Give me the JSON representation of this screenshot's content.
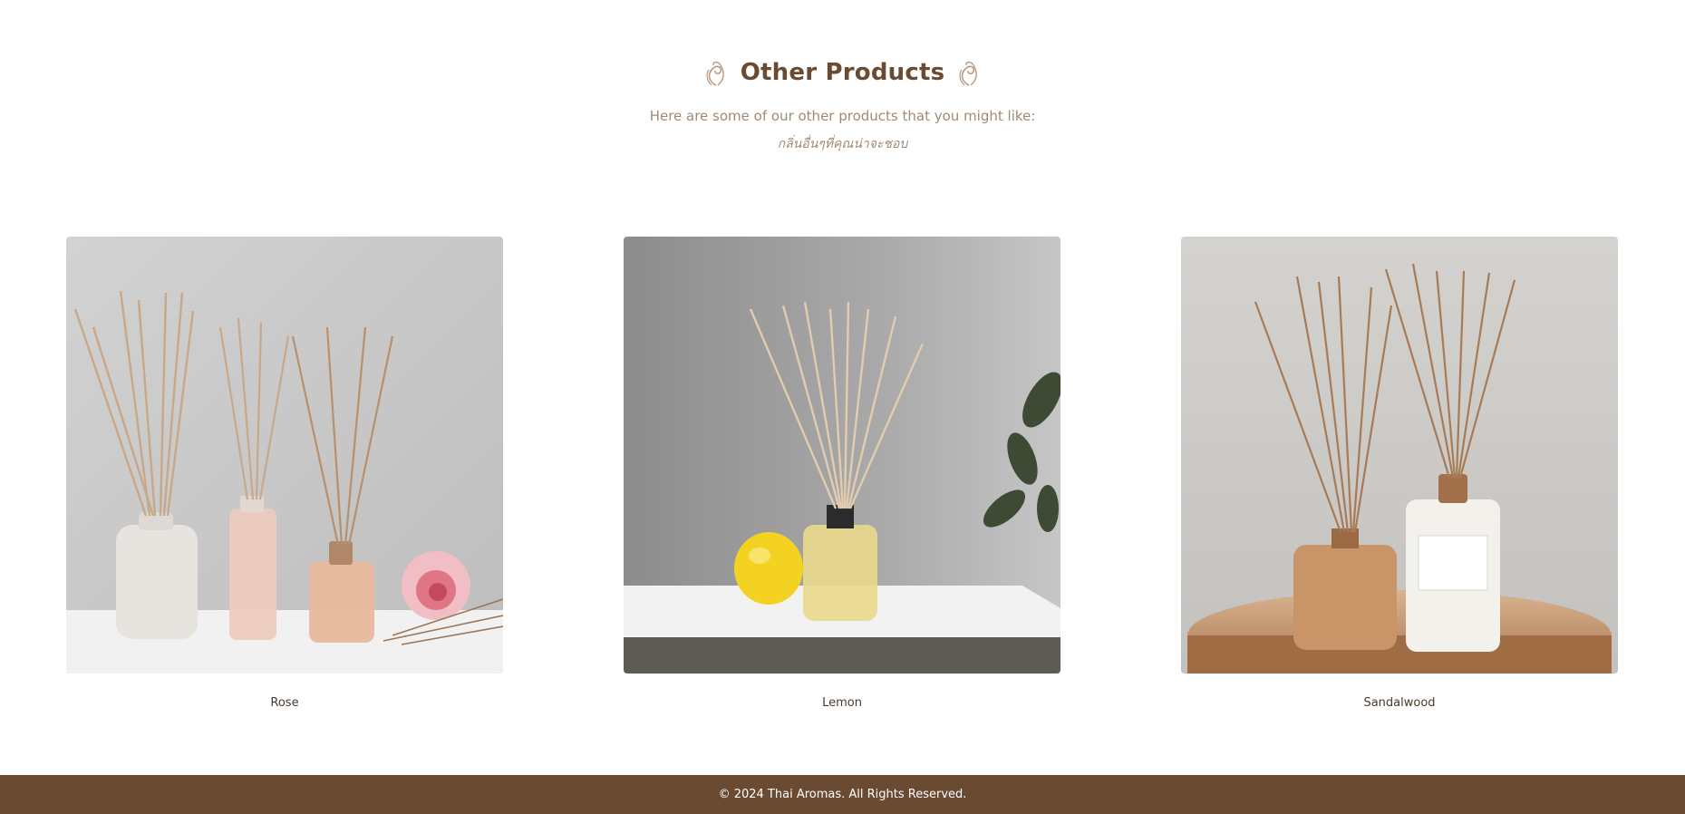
{
  "section": {
    "title": "Other Products",
    "subtitle": "Here are some of our other products that you might like:",
    "subtitle_thai": "กลิ่นอื่นๆที่คุณน่าจะชอบ",
    "decoration_icon": "swirl-ornament-icon"
  },
  "products": [
    {
      "label": "Rose",
      "image": "rose-reed-diffuser-photo"
    },
    {
      "label": "Lemon",
      "image": "lemon-reed-diffuser-photo"
    },
    {
      "label": "Sandalwood",
      "image": "sandalwood-reed-diffuser-photo"
    }
  ],
  "footer": {
    "copyright": "© 2024 Thai Aromas. All Rights Reserved."
  },
  "colors": {
    "brand_brown": "#6b4a32",
    "muted_text": "#a08a73",
    "background": "#ffffff"
  }
}
